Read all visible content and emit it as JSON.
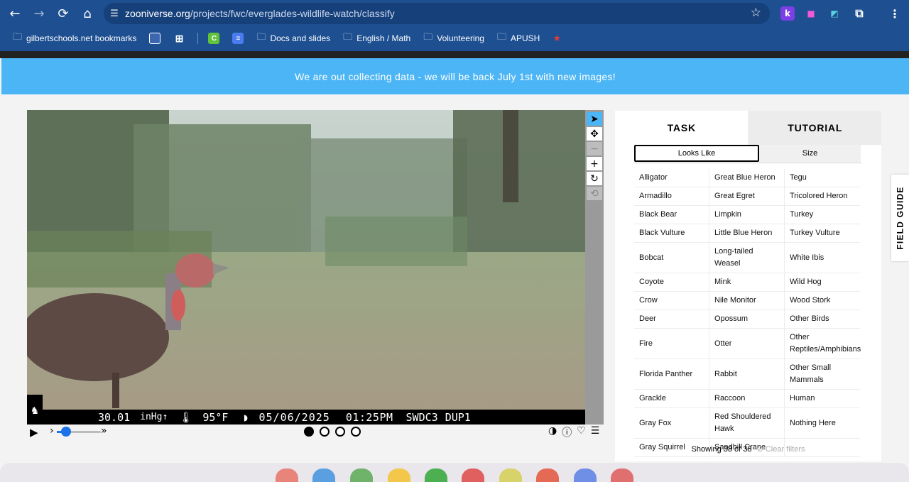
{
  "browser": {
    "url_host": "zooniverse.org",
    "url_path": "/projects/fwc/everglades-wildlife-watch/classify",
    "bookmarks": [
      {
        "label": "gilbertschools.net bookmarks"
      },
      {
        "label": "Docs and slides"
      },
      {
        "label": "English / Math"
      },
      {
        "label": "Volunteering"
      },
      {
        "label": "APUSH"
      }
    ]
  },
  "banner": {
    "text": "We are out collecting data - we will be back July 1st with new images!"
  },
  "camera_stamp": {
    "pressure": "30.01",
    "pressure_unit": "inHg",
    "pressure_trend": "↑",
    "temperature": "95°F",
    "date": "05/06/2025",
    "time": "01:25PM",
    "camera_id": "SWDC3",
    "dup": "DUP1"
  },
  "image_frames": {
    "count": 4,
    "active_index": 0
  },
  "task_panel": {
    "tabs": [
      {
        "label": "TASK"
      },
      {
        "label": "TUTORIAL"
      }
    ],
    "filters": [
      {
        "label": "Looks Like"
      },
      {
        "label": "Size"
      }
    ],
    "species_rows": [
      [
        "Alligator",
        "Great Blue Heron",
        "Tegu"
      ],
      [
        "Armadillo",
        "Great Egret",
        "Tricolored Heron"
      ],
      [
        "Black Bear",
        "Limpkin",
        "Turkey"
      ],
      [
        "Black Vulture",
        "Little Blue Heron",
        "Turkey Vulture"
      ],
      [
        "Bobcat",
        "Long-tailed Weasel",
        "White Ibis"
      ],
      [
        "Coyote",
        "Mink",
        "Wild Hog"
      ],
      [
        "Crow",
        "Nile Monitor",
        "Wood Stork"
      ],
      [
        "Deer",
        "Opossum",
        "Other Birds"
      ],
      [
        "Fire",
        "Otter",
        "Other Reptiles/Amphibians"
      ],
      [
        "Florida Panther",
        "Rabbit",
        "Other Small Mammals"
      ],
      [
        "Grackle",
        "Raccoon",
        "Human"
      ],
      [
        "Gray Fox",
        "Red Shouldered Hawk",
        "Nothing Here"
      ],
      [
        "Gray Squirrel",
        "Sandhill Crane",
        ""
      ]
    ],
    "showing_text": "Showing 38 of 38",
    "clear_filters": "Clear filters"
  },
  "field_guide": {
    "label": "FIELD GUIDE"
  },
  "colors": {
    "banner": "#4cb5f5",
    "chrome": "#1d4f91",
    "accent": "#1a73e8"
  }
}
